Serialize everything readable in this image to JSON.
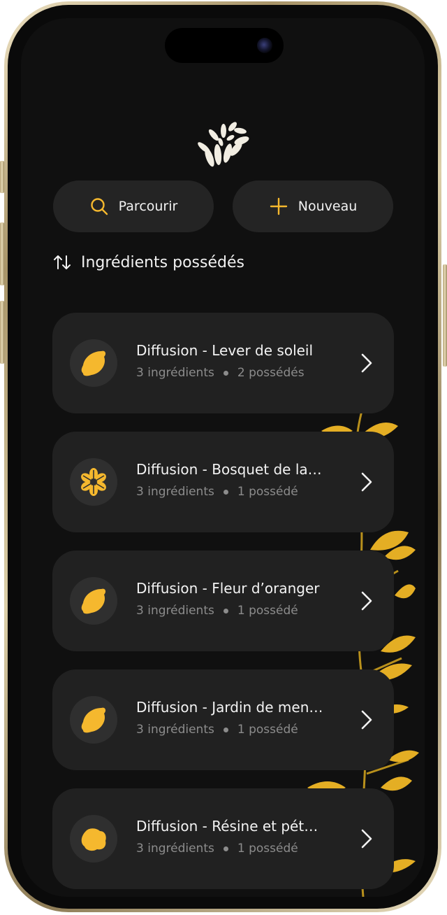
{
  "colors": {
    "accent": "#F5B82E",
    "background": "#101010",
    "card": "#212121",
    "text_primary": "#F3F3F3",
    "text_secondary": "#8C8C8C"
  },
  "header": {
    "logo_icon": "daisy-flower-logo-icon"
  },
  "actions": {
    "browse_label": "Parcourir",
    "browse_icon": "search-icon",
    "new_label": "Nouveau",
    "new_icon": "plus-icon"
  },
  "section": {
    "title": "Ingrédients possédés",
    "sort_icon": "sort-arrows-icon"
  },
  "recipes": [
    {
      "title": "Diffusion - Lever de soleil",
      "ingredients": "3 ingrédients",
      "owned": "2 possédés",
      "icon": "lemon-icon"
    },
    {
      "title": "Diffusion - Bosquet de la…",
      "ingredients": "3 ingrédients",
      "owned": "1 possédé",
      "icon": "flower-icon"
    },
    {
      "title": "Diffusion - Fleur d’oranger",
      "ingredients": "3 ingrédients",
      "owned": "1 possédé",
      "icon": "lemon-icon"
    },
    {
      "title": "Diffusion - Jardin de men…",
      "ingredients": "3 ingrédients",
      "owned": "1 possédé",
      "icon": "lemon-icon"
    },
    {
      "title": "Diffusion - Résine et pét…",
      "ingredients": "3 ingrédients",
      "owned": "1 possédé",
      "icon": "resin-blob-icon"
    }
  ]
}
